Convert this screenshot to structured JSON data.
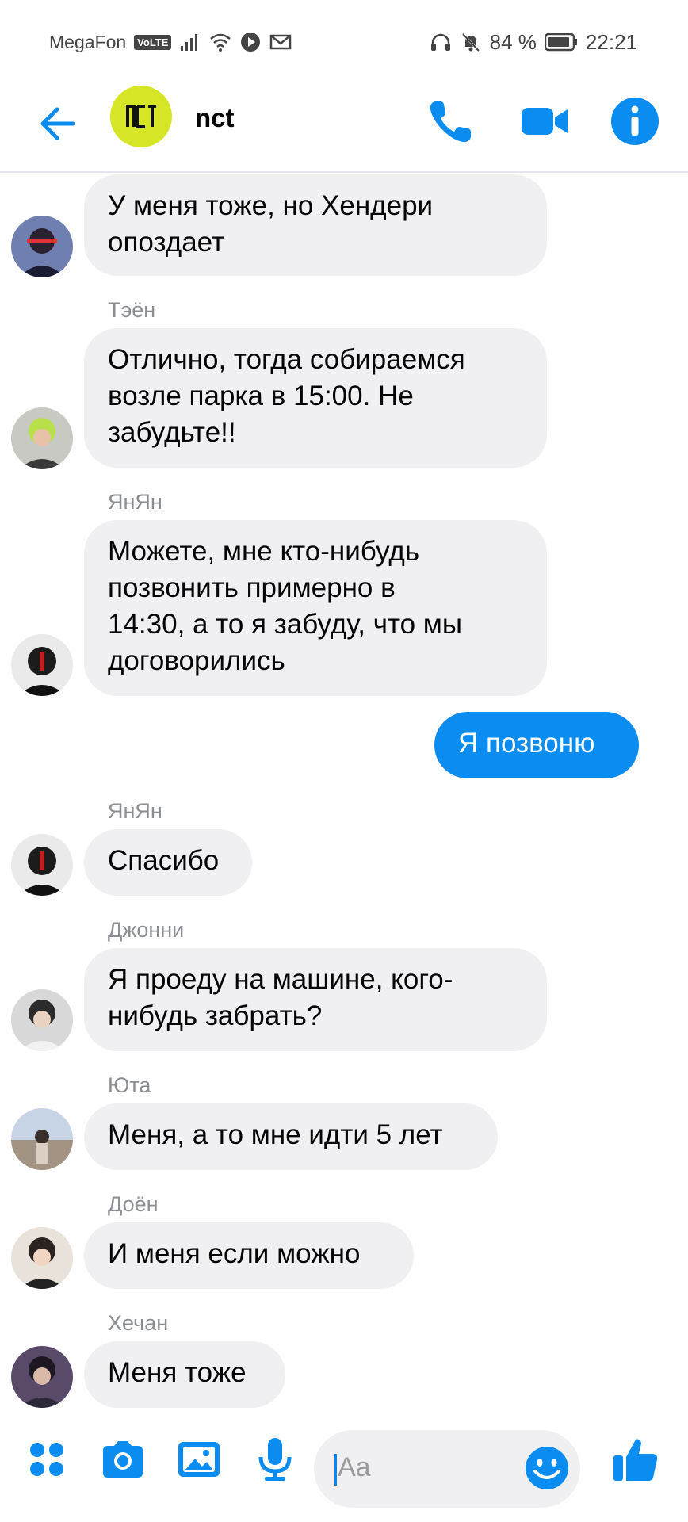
{
  "status_bar": {
    "carrier": "MegaFon",
    "volte": "VoLTE",
    "battery": "84 %",
    "time": "22:21"
  },
  "header": {
    "chat_name": "nct",
    "avatar_text": "nct"
  },
  "messages": [
    {
      "sender": "",
      "text": [
        "У меня тоже, но Хендери",
        "опоздает"
      ]
    },
    {
      "sender": "Тэён",
      "text": [
        "Отлично, тогда собираемся",
        "возле парка в 15:00. Не",
        "забудьте!!"
      ]
    },
    {
      "sender": "ЯнЯн",
      "text": [
        "Можете, мне кто-нибудь",
        "позвонить примерно в",
        "14:30, а то я забуду, что мы",
        "договорились"
      ]
    },
    {
      "outgoing": true,
      "text": [
        "Я позвоню"
      ]
    },
    {
      "sender": "ЯнЯн",
      "text": [
        "Спасибо"
      ]
    },
    {
      "sender": "Джонни",
      "text": [
        "Я проеду на машине, кого-",
        "нибудь забрать?"
      ]
    },
    {
      "sender": "Юта",
      "text": [
        "Меня, а то мне идти 5 лет"
      ]
    },
    {
      "sender": "Доён",
      "text": [
        "И меня если можно"
      ]
    },
    {
      "sender": "Хечан",
      "text": [
        "Меня тоже"
      ]
    }
  ],
  "composer": {
    "placeholder": "Aa"
  },
  "colors": {
    "accent": "#0a8cf0",
    "incoming_bubble": "#f0f0f2",
    "group_avatar": "#d6e626"
  }
}
